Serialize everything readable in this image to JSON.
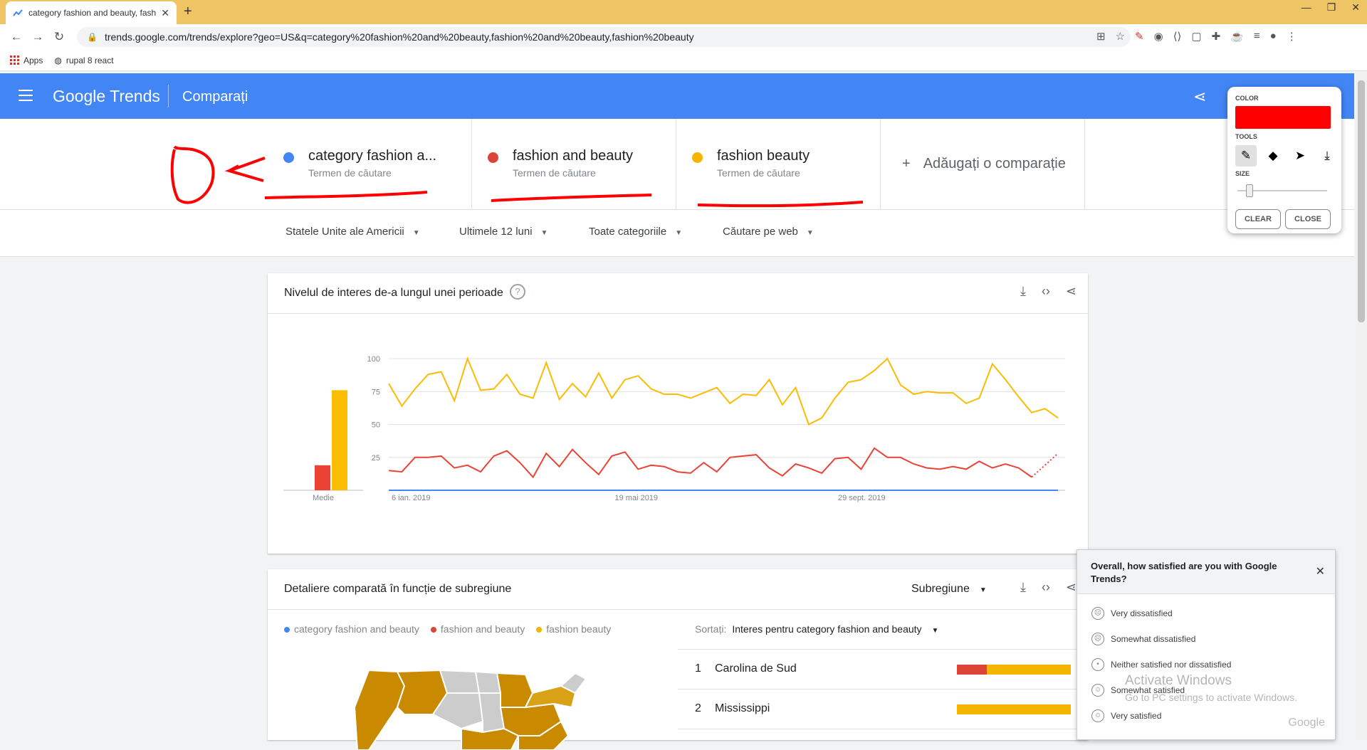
{
  "browser": {
    "tab_title": "category fashion and beauty, fashi",
    "url": "trends.google.com/trends/explore?geo=US&q=category%20fashion%20and%20beauty,fashion%20and%20beauty,fashion%20beauty",
    "bookmarks": [
      "Apps",
      "rupal 8 react"
    ]
  },
  "header": {
    "logo": "Google Trends",
    "page_title": "Comparați"
  },
  "terms": [
    {
      "name": "category fashion a...",
      "sub": "Termen de căutare",
      "color": "#4285f4"
    },
    {
      "name": "fashion and beauty",
      "sub": "Termen de căutare",
      "color": "#db4437"
    },
    {
      "name": "fashion beauty",
      "sub": "Termen de căutare",
      "color": "#f4b400"
    }
  ],
  "add_comparison": "Adăugați o comparație",
  "filters": [
    "Statele Unite ale Americii",
    "Ultimele 12 luni",
    "Toate categoriile",
    "Căutare pe web"
  ],
  "interest_card": {
    "title": "Nivelul de interes de-a lungul unei perioade",
    "average_label": "Medie"
  },
  "chart_data": {
    "type": "line",
    "ylim": [
      0,
      100
    ],
    "yticks": [
      "100",
      "75",
      "50",
      "25"
    ],
    "xtick_labels": [
      "6 ian. 2019",
      "19 mai 2019",
      "29 sept. 2019"
    ],
    "averages": [
      {
        "name": "category fashion and beauty",
        "value": 0
      },
      {
        "name": "fashion and beauty",
        "value": 19
      },
      {
        "name": "fashion beauty",
        "value": 76
      }
    ],
    "series": [
      {
        "name": "fashion beauty",
        "color": "#fbbc04",
        "values": [
          81,
          64,
          77,
          88,
          90,
          68,
          100,
          76,
          77,
          88,
          73,
          70,
          97,
          69,
          81,
          71,
          89,
          70,
          84,
          87,
          77,
          73,
          73,
          70,
          74,
          78,
          66,
          73,
          72,
          84,
          65,
          78,
          50,
          55,
          70,
          82,
          84,
          91,
          100,
          80,
          73,
          75,
          74,
          74,
          66,
          70,
          96,
          84,
          71,
          59,
          62,
          55
        ]
      },
      {
        "name": "fashion and beauty",
        "color": "#ea4335",
        "values": [
          15,
          14,
          25,
          25,
          26,
          17,
          19,
          14,
          26,
          30,
          21,
          10,
          28,
          18,
          31,
          21,
          12,
          26,
          29,
          16,
          19,
          18,
          14,
          13,
          21,
          14,
          25,
          26,
          27,
          17,
          11,
          20,
          17,
          13,
          24,
          25,
          16,
          32,
          25,
          25,
          20,
          17,
          16,
          18,
          16,
          22,
          17,
          20,
          17,
          10
        ]
      },
      {
        "name": "category fashion and beauty",
        "color": "#4285f4",
        "values": [
          0,
          0,
          0,
          0,
          0,
          0,
          0,
          0,
          0,
          0,
          0,
          0,
          0,
          0,
          0,
          0,
          0,
          0,
          0,
          0,
          0,
          0,
          0,
          0,
          0,
          0,
          0,
          0,
          0,
          0,
          0,
          0,
          0,
          0,
          0,
          0,
          0,
          0,
          0,
          0,
          0,
          0,
          0,
          0,
          0,
          0,
          0,
          0,
          0,
          0,
          0,
          0
        ]
      }
    ]
  },
  "subregion_card": {
    "title": "Detaliere comparată în funcție de subregiune",
    "select_label": "Subregiune",
    "legend": [
      {
        "label": "category fashion and beauty",
        "color": "#4285f4"
      },
      {
        "label": "fashion and beauty",
        "color": "#db4437"
      },
      {
        "label": "fashion beauty",
        "color": "#f4b400"
      }
    ],
    "sort_label": "Sortați:",
    "sort_value": "Interes pentru category fashion and beauty",
    "rows": [
      {
        "rank": "1",
        "name": "Carolina de Sud",
        "red": 0.26,
        "yellow": 0.74
      },
      {
        "rank": "2",
        "name": "Mississippi",
        "red": 0,
        "yellow": 1.0
      }
    ]
  },
  "draw_panel": {
    "color_label": "COLOR",
    "tools_label": "TOOLS",
    "size_label": "SIZE",
    "color": "#ff0000",
    "clear": "CLEAR",
    "close": "CLOSE"
  },
  "survey": {
    "question": "Overall, how satisfied are you with Google Trends?",
    "options": [
      "Very dissatisfied",
      "Somewhat dissatisfied",
      "Neither satisfied nor dissatisfied",
      "Somewhat satisfied",
      "Very satisfied"
    ],
    "brand": "Google"
  },
  "watermark": {
    "line1": "Activate Windows",
    "line2": "Go to PC settings to activate Windows."
  }
}
